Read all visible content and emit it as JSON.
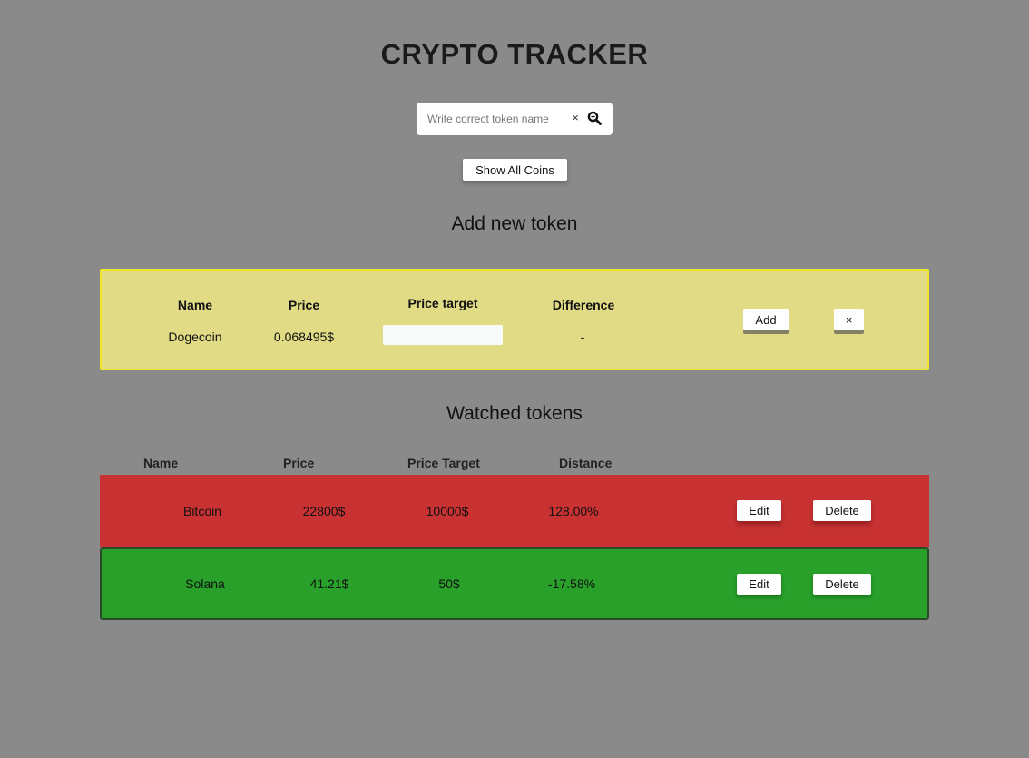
{
  "app": {
    "title": "CRYPTO TRACKER"
  },
  "search": {
    "placeholder": "Write correct token name",
    "clear_label": "×",
    "icon": "search-icon"
  },
  "show_all_label": "Show All Coins",
  "add_section": {
    "title": "Add new token",
    "headers": {
      "name": "Name",
      "price": "Price",
      "price_target": "Price target",
      "difference": "Difference"
    },
    "values": {
      "name": "Dogecoin",
      "price": "0.068495$",
      "price_target": "",
      "difference": "-"
    },
    "add_label": "Add",
    "close_label": "×",
    "panel_color": "#e2db86",
    "border_color": "#f0e62a"
  },
  "watched_section": {
    "title": "Watched tokens",
    "headers": {
      "name": "Name",
      "price": "Price",
      "price_target": "Price Target",
      "distance": "Distance"
    },
    "rows": [
      {
        "name": "Bitcoin",
        "price": "22800$",
        "price_target": "10000$",
        "distance": "128.00%",
        "edit_label": "Edit",
        "delete_label": "Delete",
        "color": "#c83232"
      },
      {
        "name": "Solana",
        "price": "41.21$",
        "price_target": "50$",
        "distance": "-17.58%",
        "edit_label": "Edit",
        "delete_label": "Delete",
        "color": "#28a02a"
      }
    ]
  },
  "colors": {
    "background": "#8a8a8a",
    "negative_row": "#c83232",
    "positive_row": "#28a02a"
  }
}
